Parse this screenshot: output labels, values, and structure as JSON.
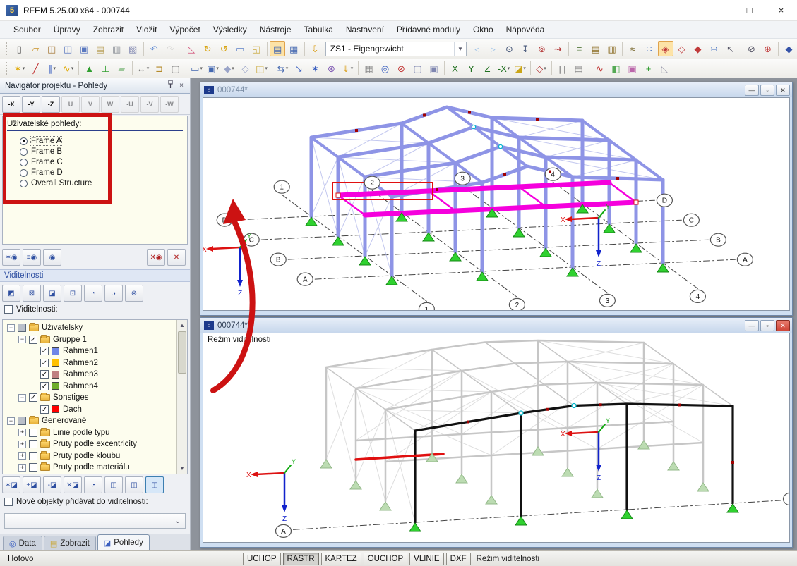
{
  "window": {
    "title": "RFEM 5.25.00 x64 - 000744",
    "minimize": "–",
    "maximize": "□",
    "close": "×"
  },
  "menu": {
    "items": [
      "Soubor",
      "Úpravy",
      "Zobrazit",
      "Vložit",
      "Výpočet",
      "Výsledky",
      "Nástroje",
      "Tabulka",
      "Nastavení",
      "Přídavné moduly",
      "Okno",
      "Nápověda"
    ]
  },
  "toolbar1": {
    "load_case_value": "ZS1 - Eigengewicht",
    "iconsA": [
      {
        "n": "new-file",
        "g": "▯",
        "c": "#555"
      },
      {
        "n": "open-file",
        "g": "▱",
        "c": "#c99227"
      },
      {
        "n": "open-project",
        "g": "◫",
        "c": "#a77b3c"
      },
      {
        "n": "save-project",
        "g": "◫",
        "c": "#5b79c0"
      },
      {
        "n": "save",
        "g": "▣",
        "c": "#5b79c0"
      },
      {
        "n": "clipboard",
        "g": "▤",
        "c": "#bba35f"
      },
      {
        "n": "print",
        "g": "▥",
        "c": "#8a8f96"
      },
      {
        "n": "print-preview",
        "g": "▧",
        "c": "#7f86b0"
      },
      {
        "n": "undo",
        "g": "↶",
        "c": "#4f7fd0",
        "sep": true
      },
      {
        "n": "redo",
        "g": "↷",
        "c": "#9aa4b5",
        "dis": true
      },
      {
        "n": "select-mode",
        "g": "◺",
        "c": "#d2527a",
        "sep": true
      },
      {
        "n": "rotate-view",
        "g": "↻",
        "c": "#d8a516"
      },
      {
        "n": "zoom-view",
        "g": "↺",
        "c": "#d8a516"
      },
      {
        "n": "select-plus",
        "g": "▭",
        "c": "#5e82c8"
      },
      {
        "n": "new-window",
        "g": "◱",
        "c": "#caa93c"
      },
      {
        "n": "show-tables",
        "g": "▤",
        "c": "#4468b0",
        "on": true,
        "sep": true
      },
      {
        "n": "table-layout",
        "g": "▦",
        "c": "#4468b0"
      },
      {
        "n": "load-case-apply",
        "g": "⇩",
        "c": "#d99c12",
        "sep": true
      }
    ],
    "iconsB": [
      {
        "n": "previous-load-case",
        "g": "◃",
        "c": "#9ec2e8"
      },
      {
        "n": "next-load-case",
        "g": "▹",
        "c": "#9ec2e8"
      },
      {
        "n": "node-values",
        "g": "⊙",
        "c": "#445577"
      },
      {
        "n": "dimension-values",
        "g": "↧",
        "c": "#445577"
      },
      {
        "n": "result-values",
        "g": "⊚",
        "c": "#b03030"
      },
      {
        "n": "max-values",
        "g": "⇝",
        "c": "#b03030"
      },
      {
        "n": "calculation-params",
        "g": "≡",
        "c": "#55793d",
        "sep": true
      },
      {
        "n": "result-table",
        "g": "▤",
        "c": "#88691e"
      },
      {
        "n": "result-table-2",
        "g": "▥",
        "c": "#88691e"
      },
      {
        "n": "snap",
        "g": "≈",
        "c": "#7a6a30",
        "sep": true
      },
      {
        "n": "grid",
        "g": "∷",
        "c": "#3f6ec0"
      },
      {
        "n": "work-plane-xy",
        "g": "◈",
        "c": "#c03a3a",
        "on": true
      },
      {
        "n": "work-plane-yz",
        "g": "◇",
        "c": "#c03a3a"
      },
      {
        "n": "work-plane-xz",
        "g": "◆",
        "c": "#c03a3a"
      },
      {
        "n": "grid-points",
        "g": "∺",
        "c": "#3f6ec0"
      },
      {
        "n": "object-snap",
        "g": "↖",
        "c": "#556"
      },
      {
        "n": "line-snap",
        "g": "⊘",
        "c": "#556",
        "sep": true
      },
      {
        "n": "rotate-snap",
        "g": "⊕",
        "c": "#c03a3a"
      },
      {
        "n": "panel-control",
        "g": "◆",
        "c": "#3553a8",
        "sep": true
      }
    ]
  },
  "toolbar2": {
    "icons": [
      {
        "n": "new-node",
        "g": "✶",
        "c": "#e0a800",
        "dd": true
      },
      {
        "n": "new-line",
        "g": "╱",
        "c": "#c03030"
      },
      {
        "n": "new-member",
        "g": "∥",
        "c": "#3a5fc0",
        "dd": true
      },
      {
        "n": "new-polyline",
        "g": "∿",
        "c": "#e0a800",
        "dd": true
      },
      {
        "n": "new-nodal-support",
        "g": "▲",
        "c": "#2f9e2f",
        "sep": true
      },
      {
        "n": "new-line-support",
        "g": "⊥",
        "c": "#2f9e2f"
      },
      {
        "n": "new-surface",
        "g": "▰",
        "c": "#9cc79a"
      },
      {
        "n": "new-dimension",
        "g": "↔",
        "c": "#555",
        "sep": true,
        "dd": true
      },
      {
        "n": "new-hinge",
        "g": "⊐",
        "c": "#b58a2a"
      },
      {
        "n": "selection-box",
        "g": "▢",
        "c": "#888"
      },
      {
        "n": "new-rectangle",
        "g": "▭",
        "c": "#4468b0",
        "sep": true,
        "dd": true
      },
      {
        "n": "new-opening",
        "g": "▣",
        "c": "#4468b0",
        "dd": true
      },
      {
        "n": "new-solid",
        "g": "◆",
        "c": "#9aa4c8",
        "dd": true
      },
      {
        "n": "view-solid",
        "g": "◇",
        "c": "#9aa4c8"
      },
      {
        "n": "copy-object",
        "g": "◫",
        "c": "#caa93c",
        "dd": true
      },
      {
        "n": "connect-members",
        "g": "⇆",
        "c": "#4468b0",
        "sep": true,
        "dd": true
      },
      {
        "n": "move-copy",
        "g": "↘",
        "c": "#3a5fc0"
      },
      {
        "n": "generate-model",
        "g": "✶",
        "c": "#3a5fc0"
      },
      {
        "n": "regenerate",
        "g": "⊛",
        "c": "#7a52b0"
      },
      {
        "n": "load-transfer",
        "g": "⇓",
        "c": "#d99c12",
        "dd": true
      },
      {
        "n": "background-layers",
        "g": "▦",
        "c": "#888",
        "sep": true
      },
      {
        "n": "zoom-window",
        "g": "◎",
        "c": "#3a5fc0"
      },
      {
        "n": "zoom-out",
        "g": "⊘",
        "c": "#c03030"
      },
      {
        "n": "view-cube",
        "g": "▢",
        "c": "#7f86b0"
      },
      {
        "n": "view-cube-solid",
        "g": "▣",
        "c": "#7f86b0"
      },
      {
        "n": "view-along-x",
        "g": "X",
        "c": "#207020",
        "sep": true
      },
      {
        "n": "view-along-y",
        "g": "Y",
        "c": "#207020"
      },
      {
        "n": "view-along-z",
        "g": "Z",
        "c": "#207020"
      },
      {
        "n": "view-along-minus-x",
        "g": "-X",
        "c": "#207020",
        "dd": true
      },
      {
        "n": "work-plane-select",
        "g": "◪",
        "c": "#caa516",
        "dd": true
      },
      {
        "n": "isometric-view",
        "g": "◇",
        "c": "#b03030",
        "sep": true,
        "dd": true
      },
      {
        "n": "member-rendering",
        "g": "∏",
        "c": "#888",
        "sep": true
      },
      {
        "n": "display-options",
        "g": "▤",
        "c": "#888"
      },
      {
        "n": "result-diagram",
        "g": "∿",
        "c": "#c03030",
        "sep": true
      },
      {
        "n": "color-panel",
        "g": "◧",
        "c": "#55aa55"
      },
      {
        "n": "render-cube",
        "g": "▣",
        "c": "#bb66aa"
      },
      {
        "n": "node-displacement",
        "g": "+",
        "c": "#2a9a2a"
      },
      {
        "n": "section-plane",
        "g": "◺",
        "c": "#99a"
      }
    ]
  },
  "navigator": {
    "title": "Navigátor projektu - Pohledy",
    "view_buttons": [
      {
        "n": "view-minus-x",
        "g": "-X",
        "en": true
      },
      {
        "n": "view-minus-y",
        "g": "-Y",
        "en": true
      },
      {
        "n": "view-minus-z",
        "g": "-Z",
        "en": true
      },
      {
        "n": "view-u",
        "g": "U"
      },
      {
        "n": "view-v",
        "g": "V"
      },
      {
        "n": "view-w",
        "g": "W"
      },
      {
        "n": "view-minus-u",
        "g": "-U"
      },
      {
        "n": "view-minus-v",
        "g": "-V"
      },
      {
        "n": "view-minus-w",
        "g": "-W"
      }
    ],
    "user_views_label": "Uživatelské pohledy:",
    "user_views": [
      {
        "label": "Frame A",
        "selected": true
      },
      {
        "label": "Frame B",
        "selected": false
      },
      {
        "label": "Frame C",
        "selected": false
      },
      {
        "label": "Frame D",
        "selected": false
      },
      {
        "label": "Overall Structure",
        "selected": false
      }
    ],
    "view_actions_left": [
      {
        "n": "add-user-view",
        "g": "✶◉"
      },
      {
        "n": "edit-user-views",
        "g": "≡◉"
      },
      {
        "n": "assign-user-view",
        "g": "◉"
      }
    ],
    "view_actions_right": [
      {
        "n": "delete-user-view",
        "g": "✕◉"
      },
      {
        "n": "cancel-view",
        "g": "✕"
      }
    ],
    "visibility_header": "Viditelnosti",
    "visibility_filters": [
      {
        "n": "visibility-by-objects",
        "g": "◩"
      },
      {
        "n": "visibility-off",
        "g": "⊠"
      },
      {
        "n": "visibility-window",
        "g": "◪"
      },
      {
        "n": "visibility-numbering",
        "g": "⊡"
      },
      {
        "n": "visibility-rotate",
        "g": "◔"
      },
      {
        "n": "visibility-shade",
        "g": "◑"
      },
      {
        "n": "visibility-cancel",
        "g": "⊗"
      }
    ],
    "visibility_checkbox_label": "Viditelnosti:",
    "tree": [
      {
        "label": "Uživatelsky",
        "level": 0,
        "exp": "-",
        "check": "part",
        "icon": "folder"
      },
      {
        "label": "Gruppe 1",
        "level": 1,
        "exp": "-",
        "check": "on",
        "icon": "folder"
      },
      {
        "label": "Rahmen1",
        "level": 2,
        "check": "on",
        "icon": "chip",
        "color": "#6f86e8"
      },
      {
        "label": "Rahmen2",
        "level": 2,
        "check": "on",
        "icon": "chip",
        "color": "#ffc000"
      },
      {
        "label": "Rahmen3",
        "level": 2,
        "check": "on",
        "icon": "chip",
        "color": "#bf8080"
      },
      {
        "label": "Rahmen4",
        "level": 2,
        "check": "on",
        "icon": "chip",
        "color": "#6fae2b"
      },
      {
        "label": "Sonstiges",
        "level": 1,
        "exp": "-",
        "check": "on",
        "icon": "folder"
      },
      {
        "label": "Dach",
        "level": 2,
        "check": "on",
        "icon": "chip",
        "color": "#ff0000"
      },
      {
        "label": "Generované",
        "level": 0,
        "exp": "-",
        "check": "part",
        "icon": "folder"
      },
      {
        "label": "Linie podle typu",
        "level": 1,
        "exp": "+",
        "check": "off",
        "icon": "folder"
      },
      {
        "label": "Pruty podle excentricity",
        "level": 1,
        "exp": "+",
        "check": "off",
        "icon": "folder"
      },
      {
        "label": "Pruty podle kloubu",
        "level": 1,
        "exp": "+",
        "check": "off",
        "icon": "folder"
      },
      {
        "label": "Pruty podle materiálu",
        "level": 1,
        "exp": "+",
        "check": "off",
        "icon": "folder"
      }
    ],
    "visibility_actions": [
      {
        "n": "new-visibility",
        "g": "✶◪",
        "en": true
      },
      {
        "n": "add-to-visibility",
        "g": "+◪"
      },
      {
        "n": "remove-from-visibility",
        "g": "-◪"
      },
      {
        "n": "edit-visibility",
        "g": "✕◪"
      },
      {
        "n": "invert-visibility",
        "g": "◔"
      },
      {
        "n": "mode-union",
        "g": "◫",
        "en": true
      },
      {
        "n": "mode-intersect",
        "g": "◫",
        "en": true
      },
      {
        "n": "mode-subtract",
        "g": "◫",
        "en": true,
        "act": true
      }
    ],
    "new_objects_label": "Nové objekty přidávat do viditelnosti:",
    "tabs": [
      {
        "label": "Data",
        "g": "◎",
        "gc": "#3a5fc0",
        "active": false
      },
      {
        "label": "Zobrazit",
        "g": "▤",
        "gc": "#caa93c",
        "active": false
      },
      {
        "label": "Pohledy",
        "g": "◪",
        "gc": "#3a5fc0",
        "active": true
      }
    ]
  },
  "windows": {
    "top": {
      "title": "000744*",
      "grid_letters": [
        "A",
        "B",
        "C",
        "D"
      ],
      "grid_numbers": [
        "1",
        "2",
        "3",
        "4"
      ],
      "axis_x": "X",
      "axis_y": "Y",
      "axis_z": "Z"
    },
    "bottom": {
      "title": "000744*",
      "mode_label": "Režim viditelnosti",
      "frame_line": "A",
      "axis_x": "X",
      "axis_y": "Y",
      "axis_z": "Z"
    }
  },
  "statusbar": {
    "left": "Hotovo",
    "buttons": [
      {
        "label": "UCHOP",
        "pressed": false
      },
      {
        "label": "RASTR",
        "pressed": true
      },
      {
        "label": "KARTEZ",
        "pressed": false
      },
      {
        "label": "OUCHOP",
        "pressed": false
      },
      {
        "label": "VLINIE",
        "pressed": false
      },
      {
        "label": "DXF",
        "pressed": false
      }
    ],
    "mode": "Režim viditelnosti"
  },
  "colors": {
    "member": "#8e94e6",
    "selected_member": "#f500dd",
    "highlight_frame": "#111111",
    "red_member": "#e01010",
    "support": "#2fd12f",
    "annotation": "#cc1212"
  }
}
